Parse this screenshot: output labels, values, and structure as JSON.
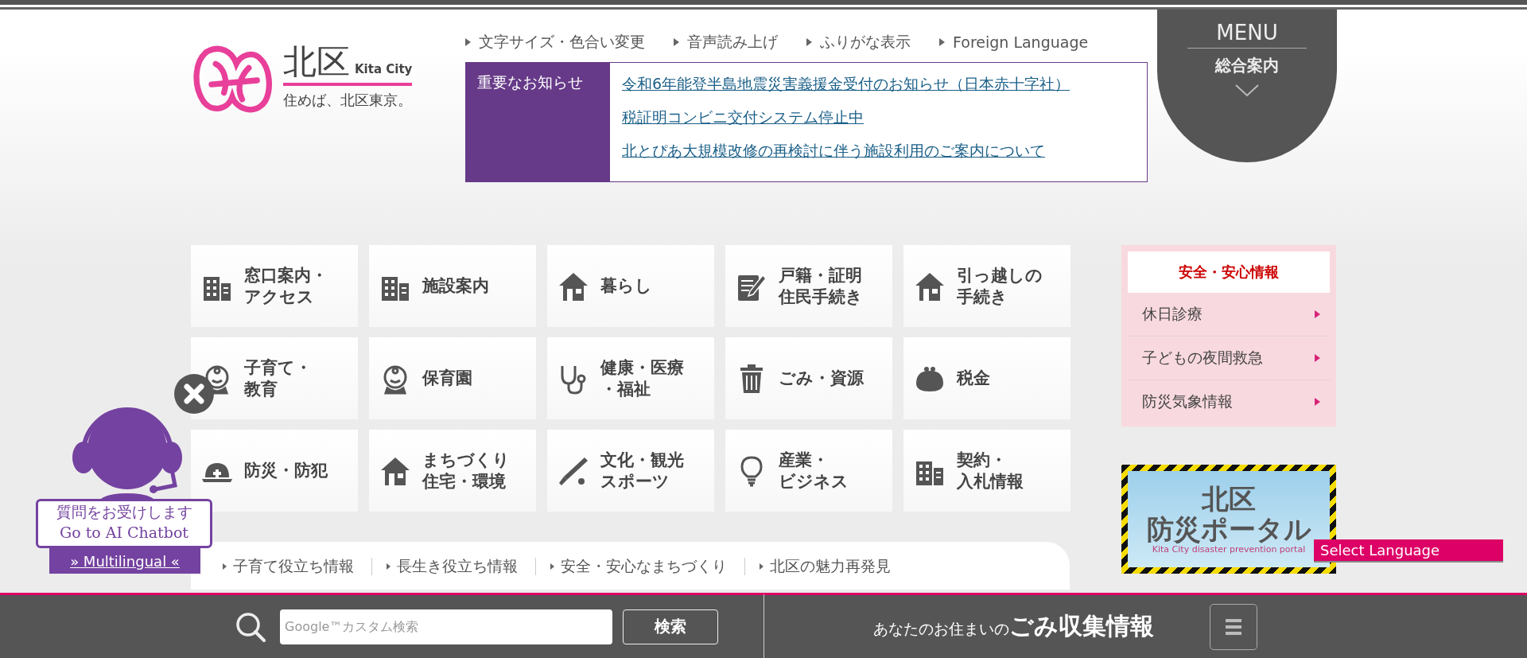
{
  "header": {
    "logo": {
      "name": "北区",
      "name_en": "Kita City",
      "slogan": "住めば、北区東京。"
    },
    "utility_links": [
      "文字サイズ・色合い変更",
      "音声読み上げ",
      "ふりがな表示",
      "Foreign Language"
    ],
    "menu_button": {
      "label": "MENU",
      "sublabel": "総合案内"
    }
  },
  "notice": {
    "heading": "重要なお知らせ",
    "links": [
      "令和6年能登半島地震災害義援金受付のお知らせ（日本赤十字社）",
      "税証明コンビニ交付システム停止中",
      "北とぴあ大規模改修の再検討に伴う施設利用のご案内について"
    ]
  },
  "categories": [
    {
      "lines": [
        "窓口案内・",
        "アクセス"
      ]
    },
    {
      "lines": [
        "施設案内"
      ]
    },
    {
      "lines": [
        "暮らし"
      ]
    },
    {
      "lines": [
        "戸籍・証明",
        "住民手続き"
      ]
    },
    {
      "lines": [
        "引っ越しの",
        "手続き"
      ]
    },
    {
      "lines": [
        "子育て・",
        "教育"
      ]
    },
    {
      "lines": [
        "保育園"
      ]
    },
    {
      "lines": [
        "健康・医療",
        "・福祉"
      ]
    },
    {
      "lines": [
        "ごみ・資源"
      ]
    },
    {
      "lines": [
        "税金"
      ]
    },
    {
      "lines": [
        "防災・防犯"
      ]
    },
    {
      "lines": [
        "まちづくり",
        "住宅・環境"
      ]
    },
    {
      "lines": [
        "文化・観光",
        "スポーツ"
      ]
    },
    {
      "lines": [
        "産業・",
        "ビジネス"
      ]
    },
    {
      "lines": [
        "契約・",
        "入札情報"
      ]
    }
  ],
  "safety_panel": {
    "title": "安全・安心情報",
    "items": [
      "休日診療",
      "子どもの夜間救急",
      "防災気象情報"
    ]
  },
  "banner": {
    "title_lines": [
      "北区",
      "防災ポータル"
    ],
    "subtitle": "Kita City disaster prevention portal"
  },
  "chatbot": {
    "line_1": "質問をお受けします",
    "line_2": "Go to AI Chatbot",
    "link": "» Multilingual «"
  },
  "language_button": "Select Language",
  "info_tabs": [
    "子育て役立ち情報",
    "長生き役立ち情報",
    "安全・安心なまちづくり",
    "北区の魅力再発見"
  ],
  "footer_bar": {
    "search_placeholder": "Google™カスタム検索",
    "search_button": "検索",
    "garbage_prefix": "あなたのお住まいの",
    "garbage_main": "ごみ収集情報"
  }
}
